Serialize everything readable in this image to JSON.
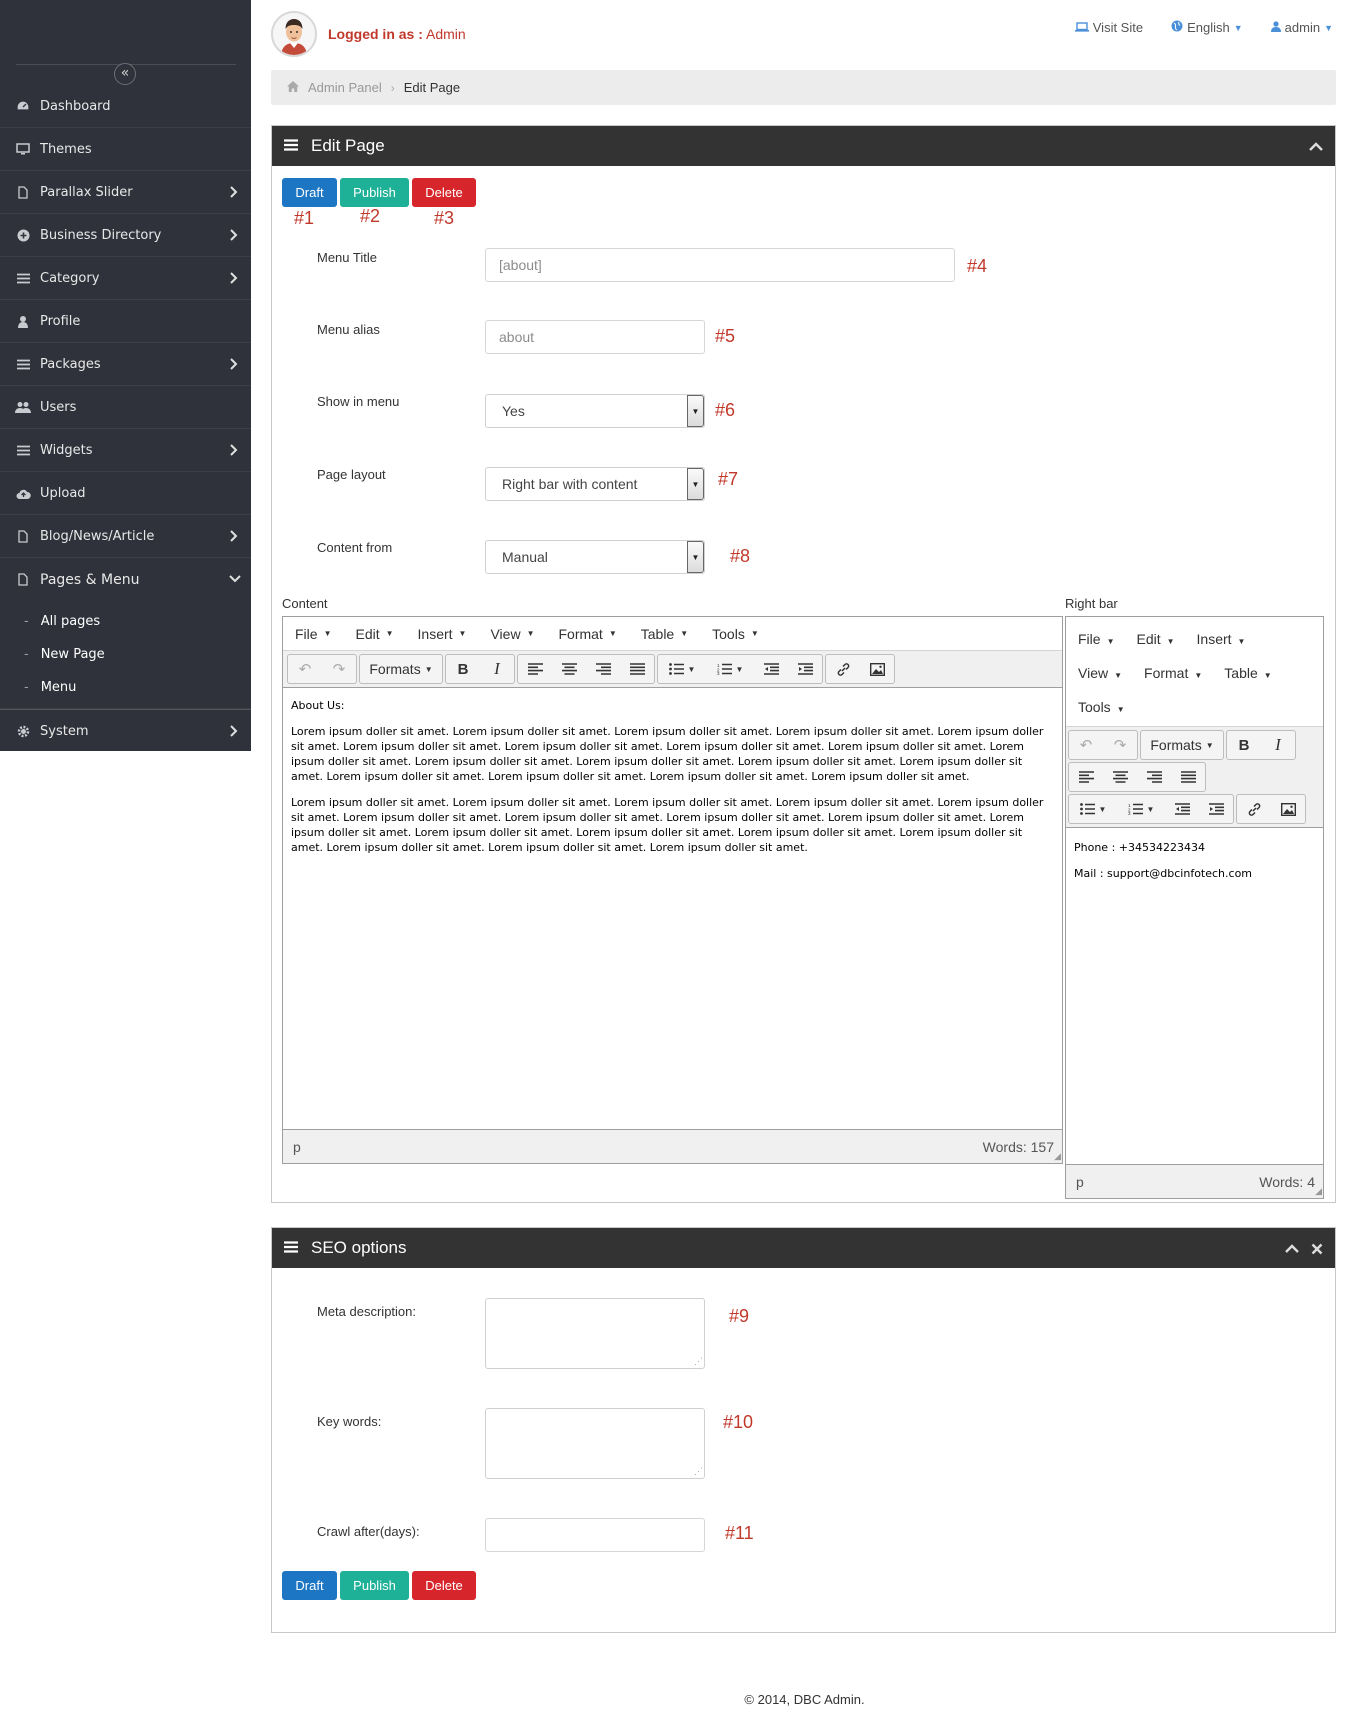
{
  "sidebar": {
    "collapse_icon": "double-chevron-left-icon",
    "items": [
      {
        "label": "Dashboard",
        "icon": "dashboard-icon",
        "has_children": false
      },
      {
        "label": "Themes",
        "icon": "monitor-icon",
        "has_children": false
      },
      {
        "label": "Parallax Slider",
        "icon": "file-icon",
        "has_children": true
      },
      {
        "label": "Business Directory",
        "icon": "plus-circle-icon",
        "has_children": true
      },
      {
        "label": "Category",
        "icon": "list-icon",
        "has_children": true
      },
      {
        "label": "Profile",
        "icon": "user-icon",
        "has_children": false
      },
      {
        "label": "Packages",
        "icon": "list-icon",
        "has_children": true
      },
      {
        "label": "Users",
        "icon": "users-icon",
        "has_children": false
      },
      {
        "label": "Widgets",
        "icon": "list-icon",
        "has_children": true
      },
      {
        "label": "Upload",
        "icon": "cloud-upload-icon",
        "has_children": false
      },
      {
        "label": "Blog/News/Article",
        "icon": "file-icon",
        "has_children": true
      },
      {
        "label": "Pages & Menu",
        "icon": "file-icon",
        "has_children": true,
        "expanded": true
      },
      {
        "label": "System",
        "icon": "gear-icon",
        "has_children": true
      }
    ],
    "sub_items": [
      "All pages",
      "New Page",
      "Menu"
    ]
  },
  "header": {
    "logged_prefix": "Logged in as :",
    "logged_user": "Admin",
    "visit_site": "Visit Site",
    "language": "English",
    "account": "admin"
  },
  "breadcrumb": {
    "root": "Admin Panel",
    "current": "Edit Page"
  },
  "edit_panel": {
    "title": "Edit Page",
    "buttons": {
      "draft": "Draft",
      "publish": "Publish",
      "delete": "Delete"
    },
    "annotations": {
      "a1": "#1",
      "a2": "#2",
      "a3": "#3",
      "a4": "#4",
      "a5": "#5",
      "a6": "#6",
      "a7": "#7",
      "a8": "#8"
    },
    "fields": {
      "menu_title": {
        "label": "Menu Title",
        "value": "[about]"
      },
      "menu_alias": {
        "label": "Menu alias",
        "placeholder": "about"
      },
      "show_in_menu": {
        "label": "Show in menu",
        "value": "Yes"
      },
      "page_layout": {
        "label": "Page layout",
        "value": "Right bar with content"
      },
      "content_from": {
        "label": "Content from",
        "value": "Manual"
      }
    }
  },
  "content_editor": {
    "label": "Content",
    "menus": [
      "File",
      "Edit",
      "Insert",
      "View",
      "Format",
      "Table",
      "Tools"
    ],
    "formats_label": "Formats",
    "heading": "About Us:",
    "paragraph1": "Lorem ipsum doller sit amet. Lorem ipsum doller sit amet. Lorem ipsum doller sit amet. Lorem ipsum doller sit amet. Lorem ipsum doller sit amet. Lorem ipsum doller sit amet. Lorem ipsum doller sit amet. Lorem ipsum doller sit amet. Lorem ipsum doller sit amet. Lorem ipsum doller sit amet. Lorem ipsum doller sit amet. Lorem ipsum doller sit amet. Lorem ipsum doller sit amet. Lorem ipsum doller sit amet. Lorem ipsum doller sit amet. Lorem ipsum doller sit amet. Lorem ipsum doller sit amet. Lorem ipsum doller sit amet.",
    "paragraph2": "Lorem ipsum doller sit amet. Lorem ipsum doller sit amet. Lorem ipsum doller sit amet. Lorem ipsum doller sit amet. Lorem ipsum doller sit amet. Lorem ipsum doller sit amet. Lorem ipsum doller sit amet. Lorem ipsum doller sit amet. Lorem ipsum doller sit amet. Lorem ipsum doller sit amet. Lorem ipsum doller sit amet. Lorem ipsum doller sit amet. Lorem ipsum doller sit amet. Lorem ipsum doller sit amet. Lorem ipsum doller sit amet. Lorem ipsum doller sit amet. Lorem ipsum doller sit amet.",
    "status_path": "p",
    "word_count": "Words: 157"
  },
  "rightbar_editor": {
    "label": "Right bar",
    "menus": [
      "File",
      "Edit",
      "Insert",
      "View",
      "Format",
      "Table",
      "Tools"
    ],
    "formats_label": "Formats",
    "line1": "Phone : +34534223434",
    "line2": "Mail : support@dbcinfotech.com",
    "status_path": "p",
    "word_count": "Words: 4"
  },
  "seo_panel": {
    "title": "SEO options",
    "annotations": {
      "a9": "#9",
      "a10": "#10",
      "a11": "#11"
    },
    "meta_label": "Meta description:",
    "keywords_label": "Key words:",
    "crawl_label": "Crawl after(days):",
    "buttons": {
      "draft": "Draft",
      "publish": "Publish",
      "delete": "Delete"
    }
  },
  "footer": "© 2014, DBC Admin.",
  "colors": {
    "sidebar": "#2f323a",
    "draft": "#1d76c4",
    "publish": "#1fb197",
    "delete": "#d6262b",
    "panel_header": "#333333",
    "annotation": "#c0392b"
  }
}
